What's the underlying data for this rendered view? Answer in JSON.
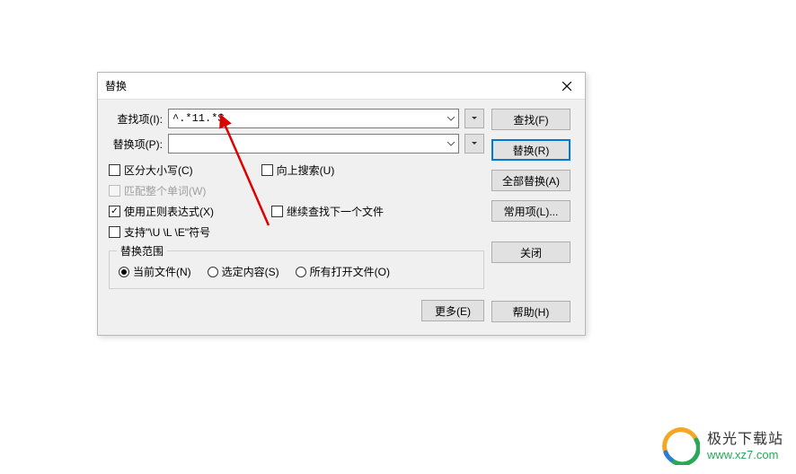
{
  "dialog": {
    "title": "替换",
    "find_label": "查找项(I):",
    "replace_label": "替换项(P):",
    "find_value": "^.*11.*$",
    "replace_value": "",
    "checks": {
      "case": "区分大小写(C)",
      "whole_word": "匹配整个单词(W)",
      "search_up": "向上搜索(U)",
      "regex": "使用正则表达式(X)",
      "search_next_file": "继续查找下一个文件",
      "escapes": "支持\"\\U \\L \\E\"符号"
    },
    "scope_title": "替换范围",
    "scope": {
      "current": "当前文件(N)",
      "selection": "选定内容(S)",
      "all_open": "所有打开文件(O)"
    },
    "more": "更多(E)"
  },
  "buttons": {
    "find": "查找(F)",
    "replace": "替换(R)",
    "replace_all": "全部替换(A)",
    "common": "常用项(L)...",
    "close": "关闭",
    "help": "帮助(H)"
  },
  "watermark": {
    "brand": "极光下载站",
    "url": "www.xz7.com"
  }
}
